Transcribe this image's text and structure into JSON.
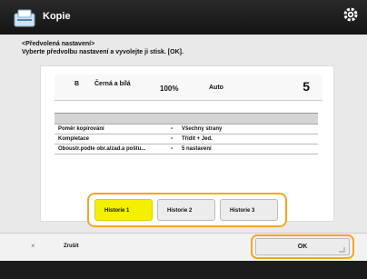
{
  "header": {
    "title": "Kopie"
  },
  "instruction": {
    "line1": "<Předvolená nastavení>",
    "line2": "Vyberte předvolbu nastavení a vyvolejte ji stisk. [OK]."
  },
  "summary": {
    "bw_mark": "B",
    "color_mode": "Černá a bílá",
    "zoom": "100%",
    "paper": "Auto",
    "copies": "5"
  },
  "settings": [
    {
      "key": "Poměr kopírování",
      "value": "Všechny strany"
    },
    {
      "key": "Kompletace",
      "value": "Třídit + Jed."
    },
    {
      "key": "Oboustr.podle obr.a/zad.a poštu...",
      "value": "5 nastavení"
    }
  ],
  "presets": [
    {
      "label": "Historie 1",
      "active": true
    },
    {
      "label": "Historie 2",
      "active": false
    },
    {
      "label": "Historie 3",
      "active": false
    }
  ],
  "footer": {
    "cancel_symbol": "×",
    "cancel_label": "Zrušit",
    "ok_label": "OK"
  },
  "colors": {
    "accent": "#f5a623",
    "selected": "#f5f000",
    "titlebar": "#1a1a1a"
  },
  "icons": {
    "app": "copy-icon",
    "settings": "gear-icon",
    "cancel": "close-icon"
  }
}
